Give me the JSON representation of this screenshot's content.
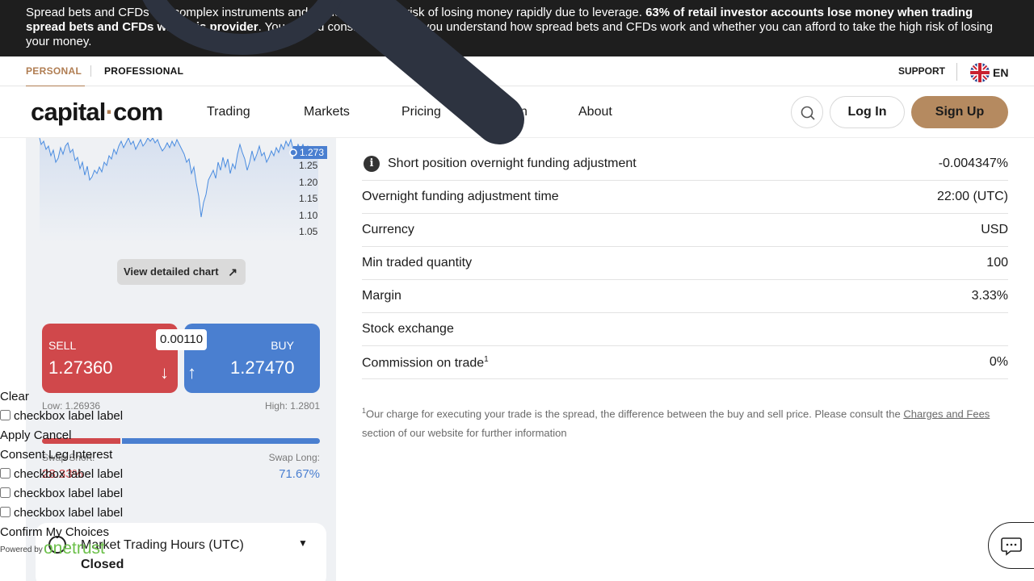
{
  "risk_banner": {
    "text_pre": "Spread bets and CFDs are complex instruments and come with a high risk of losing money rapidly due to leverage. ",
    "text_bold": "63% of retail investor accounts lose money when trading spread bets and CFDs with this provider",
    "text_post": ". You should consider whether you understand how spread bets and CFDs work and whether you can afford to take the high risk of losing your money."
  },
  "topbar": {
    "segments": [
      "PERSONAL",
      "PROFESSIONAL"
    ],
    "support": "SUPPORT",
    "language": "EN"
  },
  "nav": {
    "logo_left": "capital",
    "logo_dot": "·",
    "logo_right": "com",
    "items": [
      "Trading",
      "Markets",
      "Pricing",
      "Learn",
      "About"
    ],
    "login": "Log In",
    "signup": "Sign Up"
  },
  "chart": {
    "price_tag": "1.273",
    "y_ticks": [
      "1.25",
      "1.20",
      "1.15",
      "1.10",
      "1.05"
    ],
    "detail_button": "View detailed chart",
    "colors": {
      "line": "#4a8ce0",
      "fill_top": "#dfe6f3"
    }
  },
  "trade": {
    "sell_label": "SELL",
    "sell_price": "1.27360",
    "buy_label": "BUY",
    "buy_price": "1.27470",
    "spread": "0.00110",
    "low": "Low: 1.26936",
    "high": "High: 1.2801",
    "swap_short_label": "Swap Short:",
    "swap_short_value": "28.33%",
    "swap_long_label": "Swap Long:",
    "swap_long_value": "71.67%",
    "swap_short_fraction": 0.2833
  },
  "hours": {
    "title": "Market Trading Hours (UTC)",
    "status": "Closed"
  },
  "details": {
    "rows": [
      {
        "k": "Short position overnight funding adjustment",
        "v": "-0.004347%"
      },
      {
        "k": "Overnight funding adjustment time",
        "v": "22:00 (UTC)"
      },
      {
        "k": "Currency",
        "v": "USD"
      },
      {
        "k": "Min traded quantity",
        "v": "100"
      },
      {
        "k": "Margin",
        "v": "3.33%"
      },
      {
        "k": "Stock exchange",
        "v": ""
      },
      {
        "k": "Commission on trade",
        "sup": "1",
        "v": "0%"
      }
    ],
    "footnote_sup": "1",
    "footnote_text": "Our charge for executing your trade is the spread, the difference between the buy and sell price. Please consult the ",
    "footnote_link": "Charges and Fees",
    "footnote_tail": " section of our website for further information"
  },
  "onetrust": {
    "clear": "Clear",
    "checkbox_label": "checkbox label label",
    "apply": "Apply",
    "cancel": "Cancel",
    "consent": "Consent",
    "leg_interest": "Leg.Interest",
    "confirm": "Confirm My Choices",
    "powered_by": "Powered by",
    "logo": "onetrust"
  }
}
